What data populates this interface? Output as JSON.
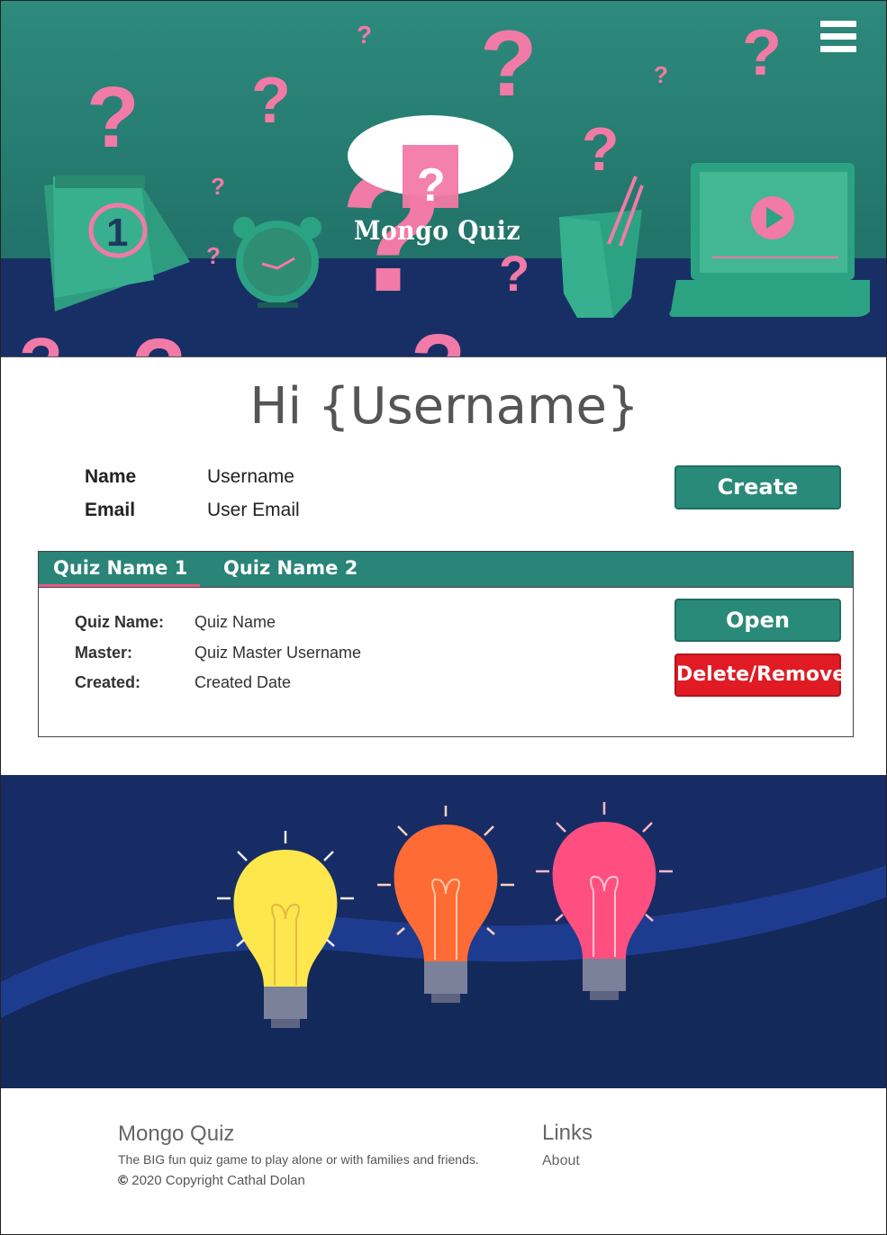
{
  "hero": {
    "logo_text": "Mongo Quiz",
    "menu_icon": "hamburger-menu-icon"
  },
  "profile": {
    "greeting": "Hi {Username}",
    "name_label": "Name",
    "name_value": "Username",
    "email_label": "Email",
    "email_value": "User Email",
    "create_label": "Create"
  },
  "quizzes": {
    "tabs": [
      {
        "label": "Quiz Name 1",
        "active": true
      },
      {
        "label": "Quiz Name 2",
        "active": false
      }
    ],
    "details": {
      "quiz_name_label": "Quiz Name:",
      "quiz_name_value": "Quiz Name",
      "master_label": "Master:",
      "master_value": "Quiz Master Username",
      "created_label": "Created:",
      "created_value": "Created Date"
    },
    "open_label": "Open",
    "delete_label": "Delete/Remove"
  },
  "footer": {
    "title": "Mongo Quiz",
    "description": "The BIG fun quiz game to play alone or with families and friends.",
    "copyright_symbol": "©",
    "copyright": "2020 Copyright Cathal Dolan",
    "links_title": "Links",
    "links": [
      "About"
    ]
  },
  "colors": {
    "brand_green": "#2a8a7a",
    "accent_pink": "#f27aa6",
    "danger_red": "#e01b24",
    "navy": "#172c64"
  }
}
